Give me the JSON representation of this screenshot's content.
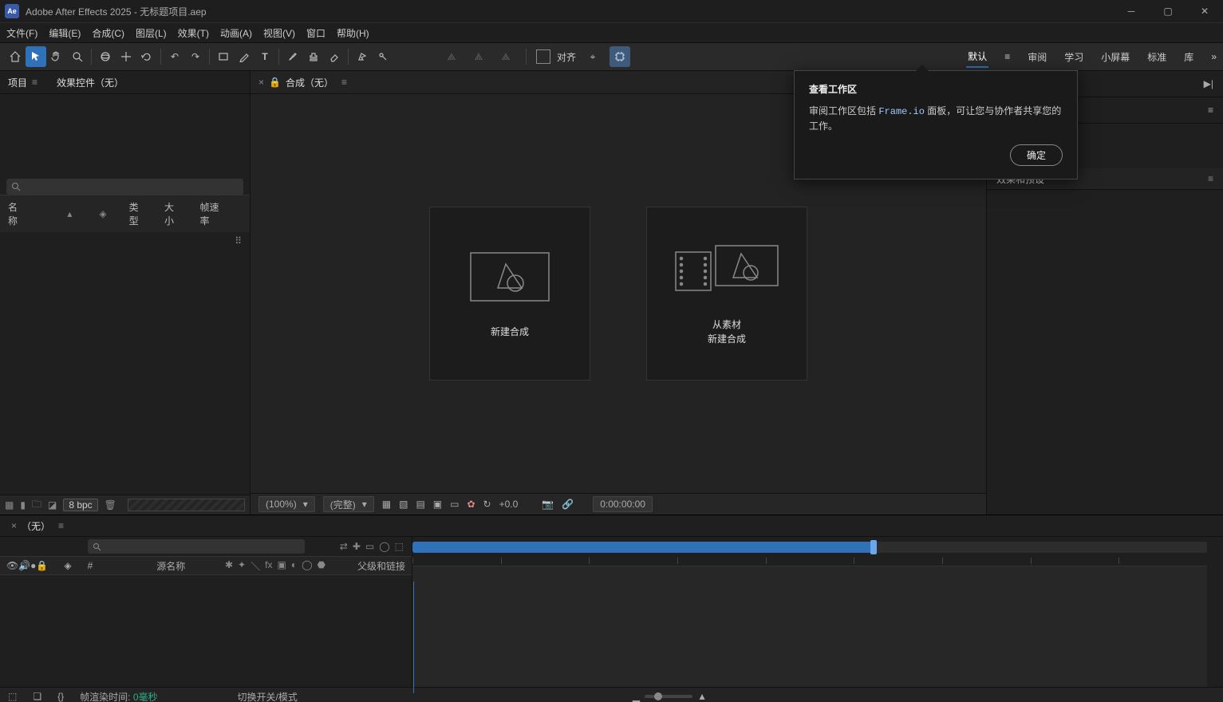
{
  "titlebar": {
    "app": "Adobe After Effects 2025",
    "project": "无标题项目.aep",
    "logo": "Ae"
  },
  "menubar": [
    "文件(F)",
    "编辑(E)",
    "合成(C)",
    "图层(L)",
    "效果(T)",
    "动画(A)",
    "视图(V)",
    "窗口",
    "帮助(H)"
  ],
  "align_label": "对齐",
  "workspaces": [
    "默认",
    "审阅",
    "学习",
    "小屏幕",
    "标准",
    "库"
  ],
  "workspace_active": "默认",
  "left": {
    "tabs": {
      "project": "项目",
      "effect_controls": "效果控件（无）"
    },
    "columns": {
      "name": "名称",
      "type": "类型",
      "size": "大小",
      "framerate": "帧速率"
    },
    "bpc": "8 bpc"
  },
  "center": {
    "tab": "合成（无）",
    "new_comp": "新建合成",
    "from_footage_line1": "从素材",
    "from_footage_line2": "新建合成",
    "zoom": "(100%)",
    "res": "(完整)",
    "exposure": "+0.0",
    "timecode": "0:00:00:00"
  },
  "right": {
    "effects_presets": "效果和预设"
  },
  "popover": {
    "title": "查看工作区",
    "text1": "审阅工作区包括 ",
    "code": "Frame.io",
    "text2": " 面板，可让您与协作者共享您的工作。",
    "ok": "确定"
  },
  "timeline": {
    "tab": "（无）",
    "src_name": "源名称",
    "parent": "父级和链接",
    "render_time_label": "帧渲染时间:",
    "render_time_value": "0毫秒",
    "toggle": "切换开关/模式"
  }
}
